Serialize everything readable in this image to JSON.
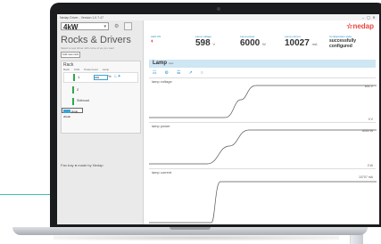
{
  "window": {
    "title": "Nedap Driver - Version 1.0.7.47"
  },
  "sidebar": {
    "power_value": "4kW",
    "app_title": "Rocks & Drivers",
    "app_desc": "Select a new driver with curve of as you want",
    "add_button": "Add new rack",
    "rack": {
      "title": "Rack",
      "headers": [
        "Rack",
        "CAN",
        "Power level",
        "Lamp"
      ],
      "slots": [
        {
          "number": "1",
          "input": "100",
          "pct": "%"
        },
        {
          "number": "2"
        },
        {
          "label": "Sideroad"
        }
      ],
      "select_label": "Jump check"
    },
    "footer": "Fan tray ● made by Nedap"
  },
  "main": {
    "logo": "☆nedap",
    "stats": [
      {
        "label": "LED ON",
        "kind": "icon"
      },
      {
        "label": "Lamp voltage",
        "value": "598",
        "unit": "V"
      },
      {
        "label": "Lamp power",
        "value": "6000",
        "unit": "W"
      },
      {
        "label": "Lamp current",
        "value": "10027",
        "unit": "mA"
      },
      {
        "label": "Configuration state",
        "text": "successfully configured"
      }
    ],
    "lamp_title": "Lamp",
    "lamp_sub": "max",
    "toolbar_icons": [
      "☷",
      "⚙",
      "☰",
      "↗",
      "○"
    ],
    "charts": [
      {
        "title": "lamp voltage",
        "top": "601 V",
        "bottom": "0 V"
      },
      {
        "title": "lamp power",
        "top": "6000 W",
        "bottom": "0 W"
      },
      {
        "title": "lamp current",
        "top": "10707 mA",
        "bottom": ""
      }
    ]
  },
  "colors": {
    "accent": "#2a8fc7",
    "brand": "#e8453c",
    "ok": "#2ea84a"
  }
}
